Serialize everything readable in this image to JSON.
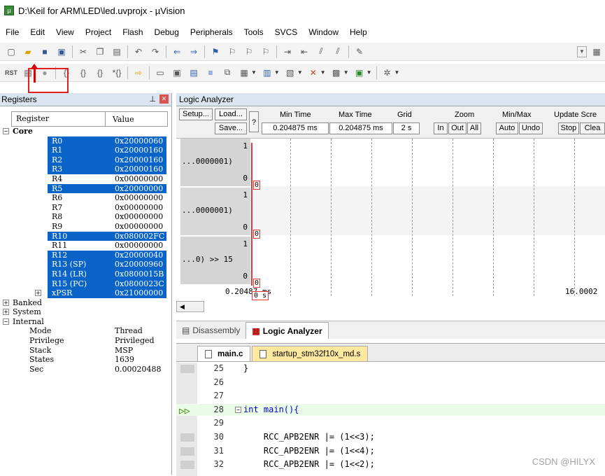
{
  "window": {
    "title": "D:\\Keil for ARM\\LED\\led.uvprojx - µVision"
  },
  "menu": [
    "File",
    "Edit",
    "View",
    "Project",
    "Flash",
    "Debug",
    "Peripherals",
    "Tools",
    "SVCS",
    "Window",
    "Help"
  ],
  "registers": {
    "panel_title": "Registers",
    "col_register": "Register",
    "col_value": "Value",
    "core_label": "Core",
    "items": [
      {
        "name": "R0",
        "value": "0x20000060",
        "selected": true
      },
      {
        "name": "R1",
        "value": "0x20000160",
        "selected": true
      },
      {
        "name": "R2",
        "value": "0x20000160",
        "selected": true
      },
      {
        "name": "R3",
        "value": "0x20000160",
        "selected": true
      },
      {
        "name": "R4",
        "value": "0x00000000",
        "selected": false
      },
      {
        "name": "R5",
        "value": "0x20000000",
        "selected": true
      },
      {
        "name": "R6",
        "value": "0x00000000",
        "selected": false
      },
      {
        "name": "R7",
        "value": "0x00000000",
        "selected": false
      },
      {
        "name": "R8",
        "value": "0x00000000",
        "selected": false
      },
      {
        "name": "R9",
        "value": "0x00000000",
        "selected": false
      },
      {
        "name": "R10",
        "value": "0x080002FC",
        "selected": true
      },
      {
        "name": "R11",
        "value": "0x00000000",
        "selected": false
      },
      {
        "name": "R12",
        "value": "0x20000040",
        "selected": true
      },
      {
        "name": "R13 (SP)",
        "value": "0x20000960",
        "selected": true
      },
      {
        "name": "R14 (LR)",
        "value": "0x0800015B",
        "selected": true
      },
      {
        "name": "R15 (PC)",
        "value": "0x0800023C",
        "selected": true
      },
      {
        "name": "xPSR",
        "value": "0x21000000",
        "selected": true
      }
    ],
    "groups": [
      "Banked",
      "System",
      "Internal"
    ],
    "internal": [
      {
        "name": "Mode",
        "value": "Thread"
      },
      {
        "name": "Privilege",
        "value": "Privileged"
      },
      {
        "name": "Stack",
        "value": "MSP"
      },
      {
        "name": "States",
        "value": "1639"
      },
      {
        "name": "Sec",
        "value": "0.00020488"
      }
    ]
  },
  "logic_analyzer": {
    "title": "Logic Analyzer",
    "setup": "Setup...",
    "load": "Load...",
    "save": "Save...",
    "help": "?",
    "min_time_label": "Min Time",
    "min_time": "0.204875 ms",
    "max_time_label": "Max Time",
    "max_time": "0.204875 ms",
    "grid_label": "Grid",
    "grid": "2 s",
    "zoom_label": "Zoom",
    "zoom_in": "In",
    "zoom_out": "Out",
    "zoom_all": "All",
    "minmax_label": "Min/Max",
    "auto": "Auto",
    "undo": "Undo",
    "update_label": "Update Scre",
    "stop": "Stop",
    "clear": "Clea",
    "signals": [
      {
        "label": "...0000001)",
        "hi": "1",
        "lo": "0",
        "val": "0"
      },
      {
        "label": "...0000001)",
        "hi": "1",
        "lo": "0",
        "val": "0"
      },
      {
        "label": "...0) >> 15",
        "hi": "1",
        "lo": "0",
        "val": "0"
      }
    ],
    "time_start": "0.20487 ms",
    "time_cursor": "0 s",
    "time_end": "16.0002"
  },
  "bottom_tabs": {
    "disassembly": "Disassembly",
    "logic": "Logic Analyzer"
  },
  "editor": {
    "tabs": [
      "main.c",
      "startup_stm32f10x_md.s"
    ],
    "lines": [
      {
        "n": "25",
        "t": "}"
      },
      {
        "n": "26",
        "t": ""
      },
      {
        "n": "27",
        "t": ""
      },
      {
        "n": "28",
        "t": "int main(){"
      },
      {
        "n": "29",
        "t": ""
      },
      {
        "n": "30",
        "t": "    RCC_APB2ENR |= (1<<3);"
      },
      {
        "n": "31",
        "t": "    RCC_APB2ENR |= (1<<4);"
      },
      {
        "n": "32",
        "t": "    RCC_APB2ENR |= (1<<2);"
      }
    ]
  },
  "watermark": "CSDN @HILYX"
}
